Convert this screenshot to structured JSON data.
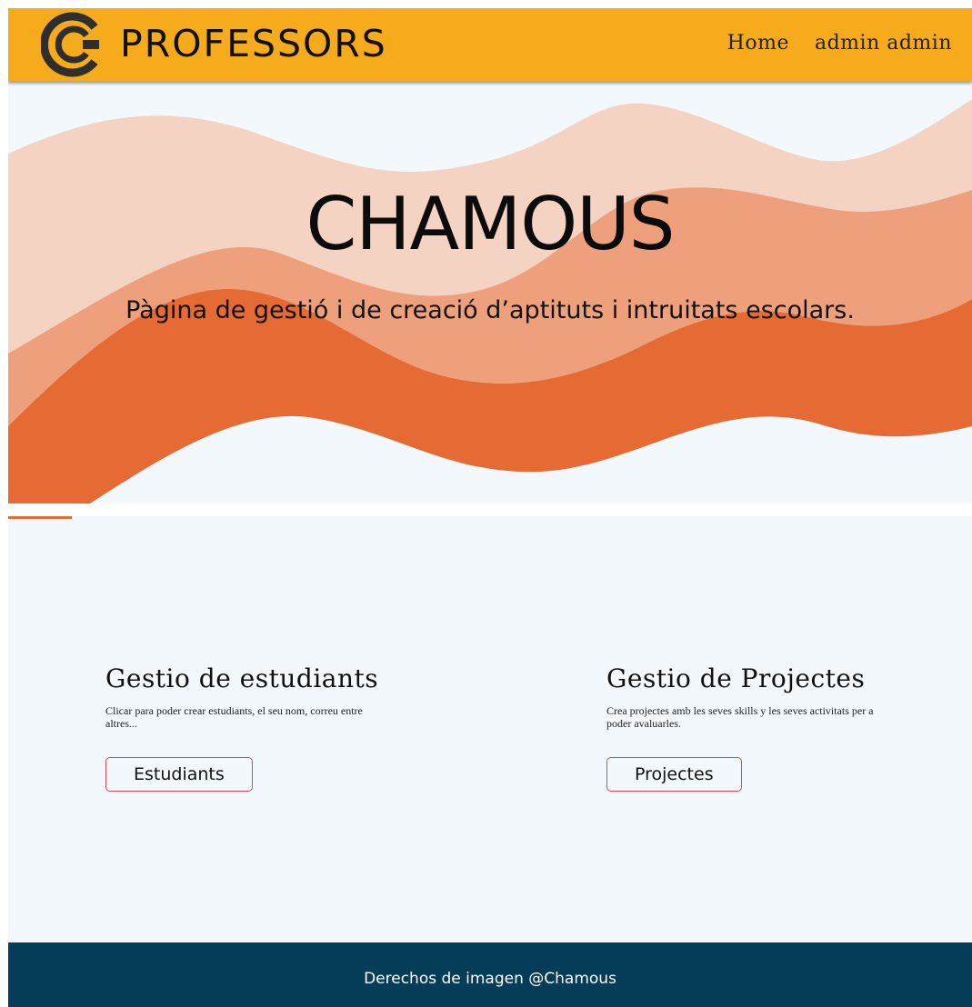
{
  "header": {
    "brand": "PROFESSORS",
    "logo_icon": "chamous-c-logo-icon",
    "nav": [
      {
        "label": "Home"
      },
      {
        "label": "admin admin"
      }
    ]
  },
  "hero": {
    "title": "CHAMOUS",
    "subtitle": "Pàgina de gestió i de creació d’aptituts i intruitats escolars."
  },
  "cards": [
    {
      "title": "Gestio de estudiants",
      "description": "Clicar para poder crear estudiants, el seu nom, correu entre altres...",
      "button": "Estudiants"
    },
    {
      "title": "Gestio de Projectes",
      "description": "Crea projectes amb les seves skills y les seves activitats per a poder avaluarles.",
      "button": "Projectes"
    }
  ],
  "footer": {
    "text": "Derechos de imagen @Chamous"
  },
  "colors": {
    "header_bg": "#f5ab1b",
    "wave_light": "#f4d3c2",
    "wave_mid": "#eea07c",
    "wave_dark": "#e56a33",
    "button_border": "#e8434d",
    "footer_bg": "#053d58",
    "page_bg": "#f3f8fc"
  }
}
